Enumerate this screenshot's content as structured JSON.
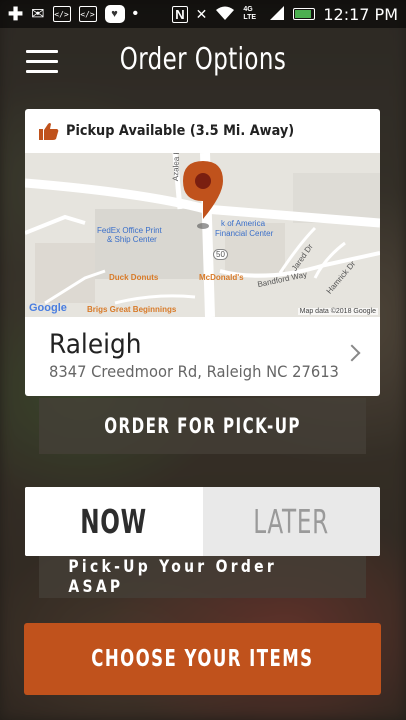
{
  "status_bar": {
    "network": "4G LTE",
    "time": "12:17 PM",
    "icons": [
      "plus-icon",
      "mail-icon",
      "code-icon",
      "code-icon",
      "heart-chat-icon",
      "more-icon",
      "nfc-icon",
      "mute-icon",
      "wifi-icon",
      "signal-icon",
      "battery-icon"
    ]
  },
  "header": {
    "title": "Order Options",
    "menu_icon": "hamburger-menu-icon"
  },
  "location_card": {
    "pickup_text": "Pickup Available (3.5 Mi. Away)",
    "pickup_icon": "thumbs-up-icon",
    "map": {
      "labels": {
        "street1": "Azalea Pl",
        "poi_fedex": "FedEx Office Print",
        "poi_fedex2": "& Ship Center",
        "poi_bank": "k of America",
        "poi_bank2": "Financial Center",
        "poi_duck": "Duck Donuts",
        "poi_mcd": "McDonald's",
        "poi_brigs": "Brigs Great Beginnings",
        "street_banford": "Bandford Way",
        "street_jared": "Jared Dr",
        "street_hamrick": "Hamrick Dr",
        "route": "50",
        "google": "Google",
        "map_data": "Map data ©2018 Google"
      },
      "pin_color": "#c0521c"
    },
    "store_name": "Raleigh",
    "store_address": "8347 Creedmoor Rd, Raleigh NC 27613"
  },
  "order_pickup_label": "ORDER FOR PICK-UP",
  "timing": {
    "now_label": "NOW",
    "later_label": "LATER",
    "selected": "NOW",
    "asap_text": "Pick-Up Your Order ASAP"
  },
  "choose_items_label": "CHOOSE YOUR ITEMS",
  "colors": {
    "accent": "#c0521c",
    "text_dark": "#2d2d2d"
  }
}
